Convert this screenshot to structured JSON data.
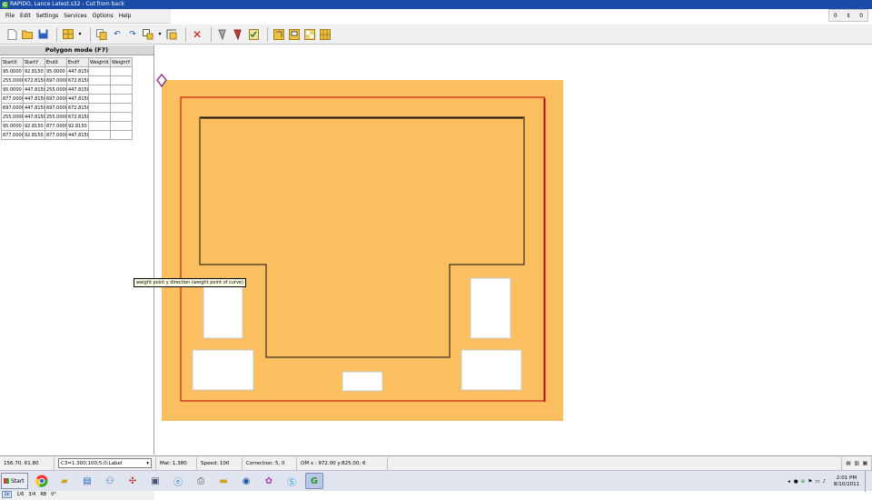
{
  "window": {
    "title": "RAPIDO, Lance Latest.s32 - Cut from back",
    "app_badge": "G"
  },
  "menu": [
    "File",
    "Edit",
    "Settings",
    "Services",
    "Options",
    "Help"
  ],
  "right_controls": {
    "value1": "0",
    "value2": "0"
  },
  "panel": {
    "title": "Polygon mode (F7)",
    "columns": [
      "StartX",
      "StartY",
      "EndX",
      "EndY",
      "WeightX",
      "WeightY"
    ],
    "rows": [
      [
        "95.0000",
        "92.8150",
        "95.0000",
        "447.8150",
        "",
        ""
      ],
      [
        "255.0000",
        "672.8150",
        "697.0000",
        "672.8150",
        "",
        ""
      ],
      [
        "95.0000",
        "447.8150",
        "255.0000",
        "447.8150",
        "",
        ""
      ],
      [
        "877.0000",
        "447.8150",
        "697.0000",
        "447.8150",
        "",
        ""
      ],
      [
        "697.0000",
        "447.8150",
        "697.0000",
        "672.8150",
        "",
        ""
      ],
      [
        "255.0000",
        "447.8150",
        "255.0000",
        "672.8150",
        "",
        ""
      ],
      [
        "95.0000",
        "92.8150",
        "877.0000",
        "92.8150",
        "",
        ""
      ],
      [
        "877.0000",
        "92.8150",
        "877.0000",
        "447.8150",
        "",
        ""
      ]
    ],
    "bottom_options": [
      "1/6",
      "3/4",
      "RB",
      "0°"
    ]
  },
  "tooltip": "weight point y direction (weight point of curve)",
  "status": {
    "coords": "156.70, 61.80",
    "layer": "C3=1.300;100;5;0;Label",
    "mat": "Mat: 1.380",
    "speed": "Speed: 100",
    "correction": "Correction: 5, 0",
    "om": "OM x : 972.00 y:825.00; 6"
  },
  "taskbar": {
    "start": "Start",
    "time": "2:01 PM",
    "date": "8/10/2011"
  },
  "colors": {
    "board": "#fbbf60",
    "cut_line": "#c00000",
    "title_bar": "#1a4ca8"
  }
}
